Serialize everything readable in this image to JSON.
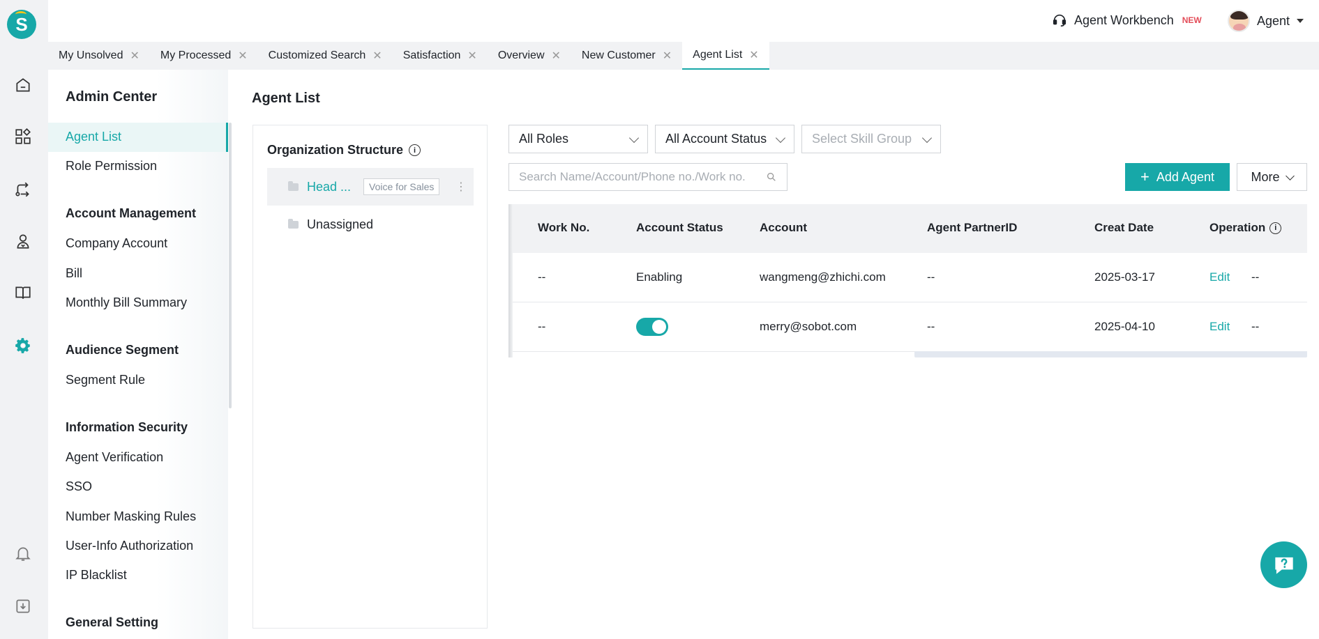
{
  "topbar": {
    "workbench_label": "Agent Workbench",
    "new_badge": "NEW",
    "user_label": "Agent"
  },
  "tabs": [
    {
      "label": "My Unsolved"
    },
    {
      "label": "My Processed"
    },
    {
      "label": "Customized Search"
    },
    {
      "label": "Satisfaction"
    },
    {
      "label": "Overview"
    },
    {
      "label": "New Customer"
    },
    {
      "label": "Agent List"
    }
  ],
  "sidebar": {
    "title": "Admin Center",
    "items": {
      "agent_list": "Agent List",
      "role_permission": "Role Permission",
      "account_management": "Account Management",
      "company_account": "Company Account",
      "bill": "Bill",
      "monthly_bill_summary": "Monthly Bill Summary",
      "audience_segment": "Audience Segment",
      "segment_rule": "Segment Rule",
      "information_security": "Information Security",
      "agent_verification": "Agent Verification",
      "sso": "SSO",
      "number_masking_rules": "Number Masking Rules",
      "user_info_authorization": "User-Info Authorization",
      "ip_blacklist": "IP Blacklist",
      "general_setting": "General Setting"
    }
  },
  "main": {
    "title": "Agent List",
    "org": {
      "title": "Organization Structure",
      "nodes": [
        {
          "label": "Head ...",
          "tag": "Voice for Sales"
        },
        {
          "label": "Unassigned"
        }
      ]
    },
    "filters": {
      "roles": "All Roles",
      "account_status": "All Account Status",
      "skill_group_placeholder": "Select Skill Group",
      "search_placeholder": "Search Name/Account/Phone no./Work no."
    },
    "buttons": {
      "add_agent": "Add Agent",
      "more": "More"
    },
    "table": {
      "headers": {
        "work_no": "Work No.",
        "account_status": "Account Status",
        "account": "Account",
        "partner_id": "Agent PartnerID",
        "create_date": "Creat Date",
        "operation": "Operation"
      },
      "rows": [
        {
          "work_no": "--",
          "status": "Enabling",
          "account": "wangmeng@zhichi.com",
          "partner_id": "--",
          "date": "2025-03-17",
          "edit": "Edit",
          "extra": "--"
        },
        {
          "work_no": "--",
          "status_toggle": true,
          "account": "merry@sobot.com",
          "partner_id": "--",
          "date": "2025-04-10",
          "edit": "Edit",
          "extra": "--"
        }
      ]
    }
  },
  "colors": {
    "accent": "#17a8a8",
    "rail_bg": "#f1f2f4"
  }
}
